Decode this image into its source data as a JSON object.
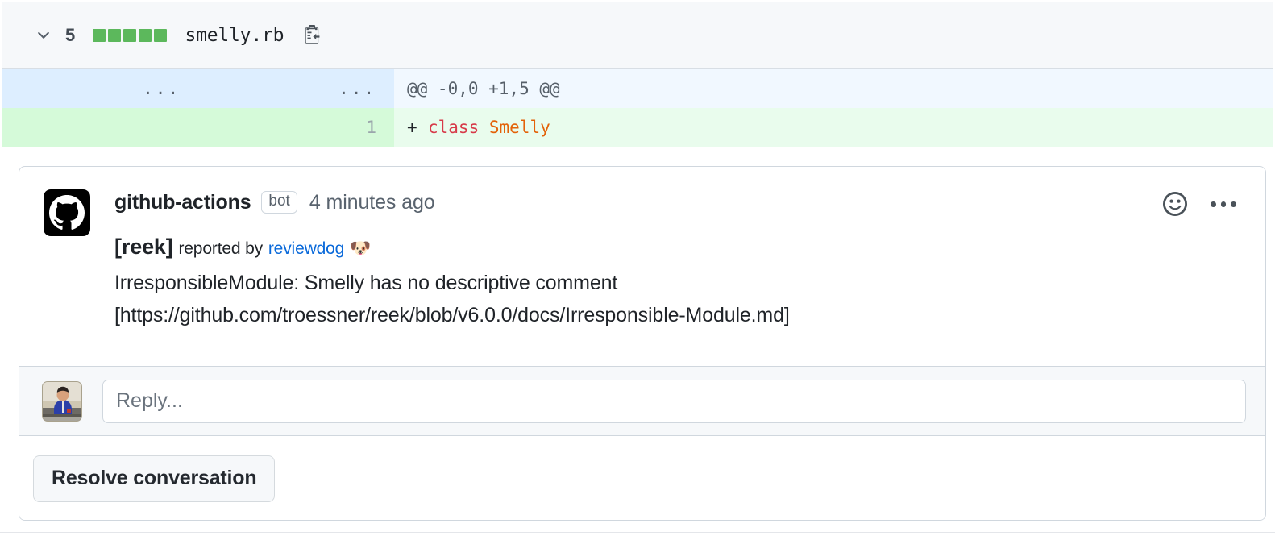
{
  "file_header": {
    "collapse_icon": "chevron-down-icon",
    "change_count": "5",
    "diffstat_blocks": 5,
    "diffstat_color": "#5cb85c",
    "filename": "smelly.rb",
    "copy_path_icon": "copy-path-clipboard-icon"
  },
  "diff": {
    "rows": [
      {
        "type": "hunk",
        "old_line": "...",
        "new_line": "...",
        "marker": "",
        "text": "@@ -0,0 +1,5 @@"
      },
      {
        "type": "added",
        "old_line": "",
        "new_line": "1",
        "marker": "+",
        "code_keyword": "class",
        "code_class_name": "Smelly"
      }
    ],
    "colors": {
      "hunk_gutter": "#ddeeff",
      "hunk_content": "#f1f8ff",
      "added_gutter": "#d5fad9",
      "added_content": "#e9fced",
      "keyword": "#d73a49",
      "class_name": "#e36209"
    }
  },
  "comment": {
    "avatar_icon": "github-logo-avatar",
    "author": "github-actions",
    "bot_badge": "bot",
    "timestamp": "4 minutes ago",
    "reaction_icon": "smiley-face-icon",
    "menu_icon": "kebab-menu-icon",
    "body": {
      "tool_tag": "[reek]",
      "reported_by_label": "reported by",
      "reporter_link": "reviewdog",
      "reporter_emoji": "🐶",
      "message": "IrresponsibleModule: Smelly has no descriptive comment",
      "doc_url": "[https://github.com/troessner/reek/blob/v6.0.0/docs/Irresponsible-Module.md]"
    },
    "link_color": "#0969da"
  },
  "reply": {
    "avatar_name": "user-avatar",
    "placeholder": "Reply...",
    "value": ""
  },
  "resolve": {
    "label": "Resolve conversation"
  }
}
